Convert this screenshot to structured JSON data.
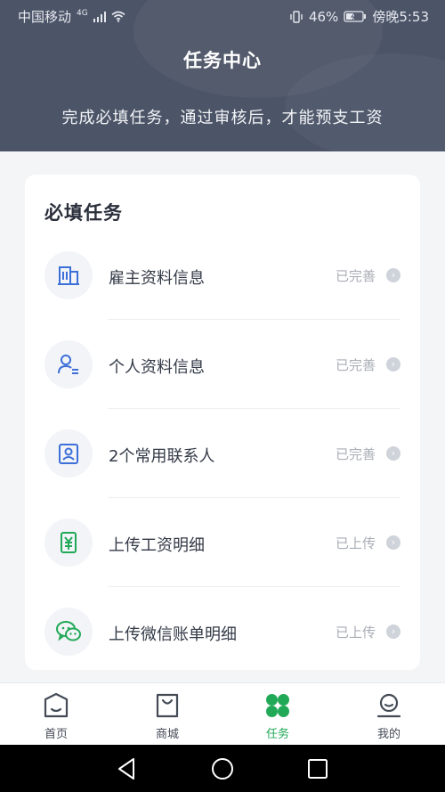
{
  "status_bar": {
    "carrier": "中国移动",
    "network": "4G",
    "battery_percent": "46%",
    "time": "傍晚5:53"
  },
  "header": {
    "title": "任务中心",
    "subtitle": "完成必填任务，通过审核后，才能预支工资",
    "background_color": "#4c5568"
  },
  "card": {
    "title": "必填任务",
    "tasks": [
      {
        "label": "雇主资料信息",
        "status": "已完善",
        "icon": "building-icon",
        "icon_color": "#3d6fd8"
      },
      {
        "label": "个人资料信息",
        "status": "已完善",
        "icon": "user-icon",
        "icon_color": "#3d6fd8"
      },
      {
        "label": "2个常用联系人",
        "status": "已完善",
        "icon": "contact-card-icon",
        "icon_color": "#3d6fd8"
      },
      {
        "label": "上传工资明细",
        "status": "已上传",
        "icon": "yuan-document-icon",
        "icon_color": "#22a957"
      },
      {
        "label": "上传微信账单明细",
        "status": "已上传",
        "icon": "wechat-icon",
        "icon_color": "#22a957"
      }
    ]
  },
  "tabbar": {
    "active_color": "#22a957",
    "items": [
      {
        "label": "首页",
        "icon": "home-icon",
        "active": false
      },
      {
        "label": "商城",
        "icon": "shopping-bag-icon",
        "active": false
      },
      {
        "label": "任务",
        "icon": "tasks-icon",
        "active": true
      },
      {
        "label": "我的",
        "icon": "profile-icon",
        "active": false
      }
    ]
  },
  "navbar": {
    "icons": [
      "back-icon",
      "home-circle-icon",
      "recents-icon"
    ]
  }
}
